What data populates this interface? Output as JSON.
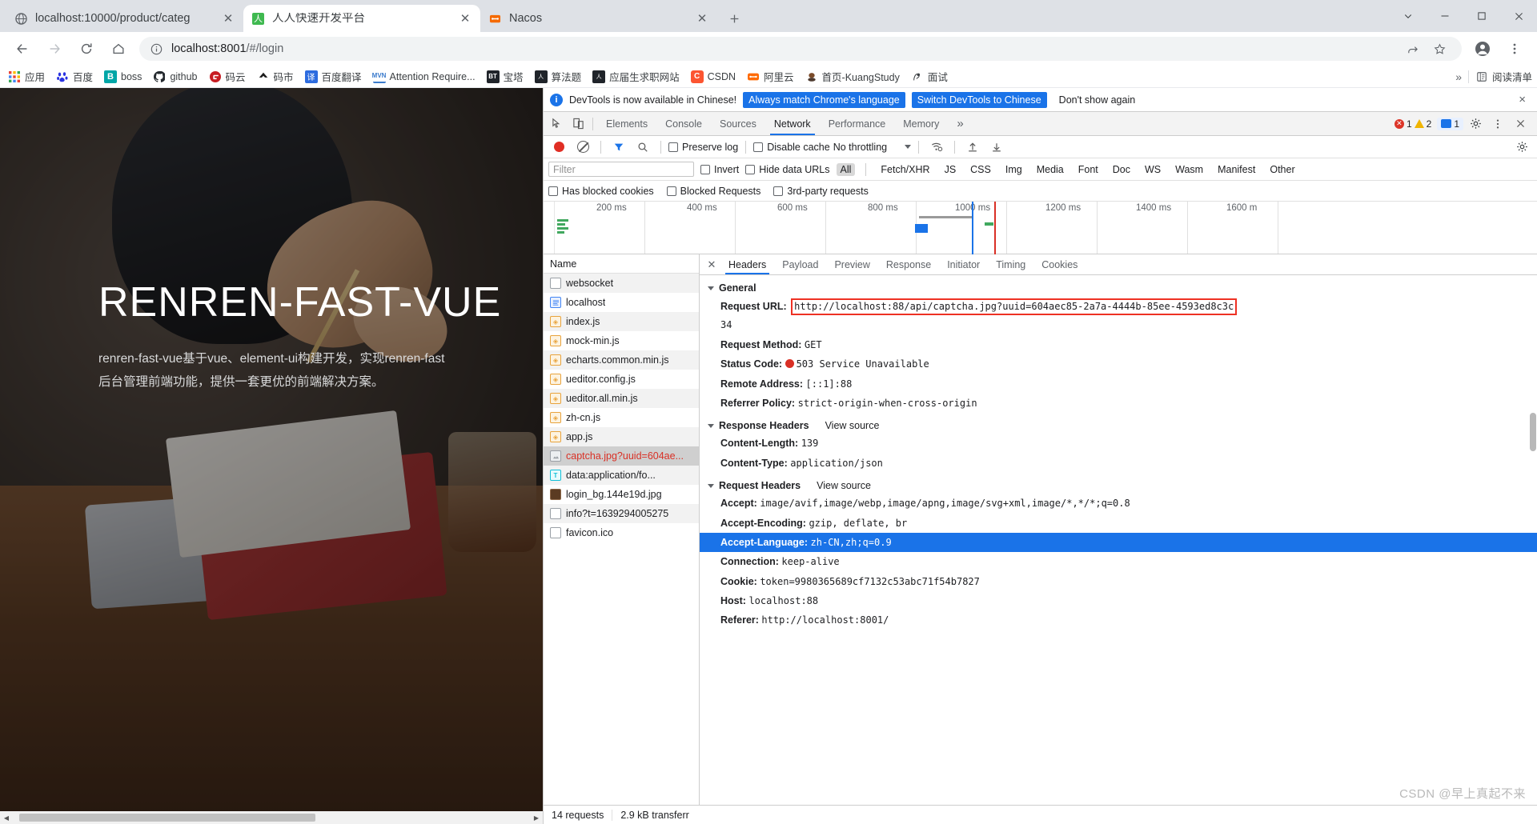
{
  "window": {
    "controls": [
      "chevron-down",
      "minimize",
      "maximize",
      "close"
    ]
  },
  "tabs": [
    {
      "title": "localhost:10000/product/categ",
      "favicon": "globe-icon",
      "active": false
    },
    {
      "title": "人人快速开发平台",
      "favicon": "renren-icon",
      "active": true
    },
    {
      "title": "Nacos",
      "favicon": "nacos-icon",
      "active": false
    }
  ],
  "newtab_label": "+",
  "nav": {
    "back": "←",
    "forward": "→",
    "reload": "C",
    "home": "⌂",
    "url_prefix": "localhost:8001",
    "url_suffix": "/#/login",
    "info_icon": "info-circle-icon",
    "share_icon": "share-icon",
    "star_icon": "star-icon",
    "profile_icon": "profile-avatar-icon",
    "menu_icon": "three-dot-menu-icon"
  },
  "bookmarks": [
    {
      "label": "应用",
      "icon": "apps-grid-icon",
      "color": "#4285f4"
    },
    {
      "label": "百度",
      "icon": "baidu-icon",
      "color": "#2932e1"
    },
    {
      "label": "boss",
      "icon": "boss-icon",
      "color": "#00a6a7"
    },
    {
      "label": "github",
      "icon": "github-icon",
      "color": "#24292e"
    },
    {
      "label": "码云",
      "icon": "gitee-icon",
      "color": "#c71d23"
    },
    {
      "label": "码市",
      "icon": "coding-icon",
      "color": "#1a1a1a"
    },
    {
      "label": "百度翻译",
      "icon": "fanyi-icon",
      "color": "#2d6cdf"
    },
    {
      "label": "Attention Require...",
      "icon": "mvn-icon",
      "color": "#3b7bcc"
    },
    {
      "label": "宝塔",
      "icon": "bt-icon",
      "color": "#20242a"
    },
    {
      "label": "算法题",
      "icon": "leetcode-icon",
      "color": "#20242a"
    },
    {
      "label": "应届生求职网站",
      "icon": "yjs-icon",
      "color": "#20242a"
    },
    {
      "label": "CSDN",
      "icon": "csdn-icon",
      "color": "#fc5531"
    },
    {
      "label": "阿里云",
      "icon": "aliyun-icon",
      "color": "#ff6a00"
    },
    {
      "label": "首页-KuangStudy",
      "icon": "kuangstudy-icon",
      "color": "#7a4b2a"
    },
    {
      "label": "面试",
      "icon": "mianshi-icon",
      "color": "#3c4043"
    }
  ],
  "bookmarks_right": {
    "overflow": "»",
    "reading_list": "阅读清单",
    "reading_list_icon": "reading-list-icon"
  },
  "page": {
    "title": "RENREN-FAST-VUE",
    "subtitle_line1": "renren-fast-vue基于vue、element-ui构建开发，实现renren-fast",
    "subtitle_line2": "后台管理前端功能，提供一套更优的前端解决方案。"
  },
  "devtools": {
    "banner": {
      "icon": "info-icon",
      "text": "DevTools is now available in Chinese!",
      "btn_primary": "Always match Chrome's language",
      "btn_secondary": "Switch DevTools to Chinese",
      "btn_dismiss": "Don't show again",
      "close": "×"
    },
    "panel_tabs": [
      {
        "label": "Elements",
        "active": false
      },
      {
        "label": "Console",
        "active": false
      },
      {
        "label": "Sources",
        "active": false
      },
      {
        "label": "Network",
        "active": true
      },
      {
        "label": "Performance",
        "active": false
      },
      {
        "label": "Memory",
        "active": false
      }
    ],
    "panel_overflow": "»",
    "inspect_icon": "inspect-cursor-icon",
    "device_icon": "device-toolbar-icon",
    "counters": {
      "errors": "1",
      "warnings": "2",
      "messages": "1"
    },
    "settings_icon": "gear-icon",
    "more_icon": "three-dot-menu-icon",
    "close_icon": "close-icon",
    "network_toolbar": {
      "record_icon": "record-dot-icon",
      "clear_icon": "clear-icon",
      "filter_icon": "filter-funnel-icon",
      "search_icon": "search-icon",
      "preserve_log": "Preserve log",
      "disable_cache": "Disable cache",
      "throttling": "No throttling",
      "wifi_icon": "network-conditions-icon",
      "import_icon": "import-har-icon",
      "export_icon": "export-har-icon",
      "settings_icon": "gear-icon"
    },
    "filter_row": {
      "placeholder": "Filter",
      "invert": "Invert",
      "hide_data_urls": "Hide data URLs",
      "types": [
        "All",
        "Fetch/XHR",
        "JS",
        "CSS",
        "Img",
        "Media",
        "Font",
        "Doc",
        "WS",
        "Wasm",
        "Manifest",
        "Other"
      ],
      "selected_type": "All"
    },
    "filter_row2": {
      "has_blocked_cookies": "Has blocked cookies",
      "blocked_requests": "Blocked Requests",
      "third_party": "3rd-party requests"
    },
    "overview_ticks": [
      "200 ms",
      "400 ms",
      "600 ms",
      "800 ms",
      "1000 ms",
      "1200 ms",
      "1400 ms",
      "1600 m"
    ],
    "requests_header": "Name",
    "requests": [
      {
        "name": "websocket",
        "type": "doc",
        "selected": false
      },
      {
        "name": "localhost",
        "type": "html",
        "selected": false
      },
      {
        "name": "index.js",
        "type": "js",
        "selected": false
      },
      {
        "name": "mock-min.js",
        "type": "js",
        "selected": false
      },
      {
        "name": "echarts.common.min.js",
        "type": "js",
        "selected": false
      },
      {
        "name": "ueditor.config.js",
        "type": "js",
        "selected": false
      },
      {
        "name": "ueditor.all.min.js",
        "type": "js",
        "selected": false
      },
      {
        "name": "zh-cn.js",
        "type": "js",
        "selected": false
      },
      {
        "name": "app.js",
        "type": "js",
        "selected": false
      },
      {
        "name": "captcha.jpg?uuid=604ae...",
        "type": "img",
        "selected": true
      },
      {
        "name": "data:application/fo...",
        "type": "txt",
        "selected": false
      },
      {
        "name": "login_bg.144e19d.jpg",
        "type": "pic",
        "selected": false
      },
      {
        "name": "info?t=1639294005275",
        "type": "doc",
        "selected": false
      },
      {
        "name": "favicon.ico",
        "type": "doc",
        "selected": false
      }
    ],
    "detail_tabs": [
      {
        "label": "Headers",
        "active": true
      },
      {
        "label": "Payload",
        "active": false
      },
      {
        "label": "Preview",
        "active": false
      },
      {
        "label": "Response",
        "active": false
      },
      {
        "label": "Initiator",
        "active": false
      },
      {
        "label": "Timing",
        "active": false
      },
      {
        "label": "Cookies",
        "active": false
      }
    ],
    "general": {
      "title": "General",
      "request_url_key": "Request URL:",
      "request_url_value": "http://localhost:88/api/captcha.jpg?uuid=604aec85-2a7a-4444b-85ee-4593ed8c3c",
      "request_url_wrap": "34",
      "request_method_key": "Request Method:",
      "request_method_value": "GET",
      "status_code_key": "Status Code:",
      "status_code_value": "503 Service Unavailable",
      "remote_address_key": "Remote Address:",
      "remote_address_value": "[::1]:88",
      "referrer_policy_key": "Referrer Policy:",
      "referrer_policy_value": "strict-origin-when-cross-origin"
    },
    "response_headers": {
      "title": "Response Headers",
      "view_source": "View source",
      "rows": [
        {
          "k": "Content-Length:",
          "v": "139"
        },
        {
          "k": "Content-Type:",
          "v": "application/json"
        }
      ]
    },
    "request_headers": {
      "title": "Request Headers",
      "view_source": "View source",
      "rows": [
        {
          "k": "Accept:",
          "v": "image/avif,image/webp,image/apng,image/svg+xml,image/*,*/*;q=0.8",
          "hl": false
        },
        {
          "k": "Accept-Encoding:",
          "v": "gzip, deflate, br",
          "hl": false
        },
        {
          "k": "Accept-Language:",
          "v": "zh-CN,zh;q=0.9",
          "hl": true
        },
        {
          "k": "Connection:",
          "v": "keep-alive",
          "hl": false
        },
        {
          "k": "Cookie:",
          "v": "token=9980365689cf7132c53abc71f54b7827",
          "hl": false
        },
        {
          "k": "Host:",
          "v": "localhost:88",
          "hl": false
        },
        {
          "k": "Referer:",
          "v": "http://localhost:8001/",
          "hl": false
        }
      ]
    },
    "status_bar": {
      "requests": "14 requests",
      "transferred": "2.9 kB transferr"
    }
  },
  "watermark": "CSDN @早上真起不来",
  "colors": {
    "accent": "#1a73e8",
    "error": "#d93025",
    "highlight_box": "#ee3124",
    "selected_row": "#cfcfcf"
  }
}
